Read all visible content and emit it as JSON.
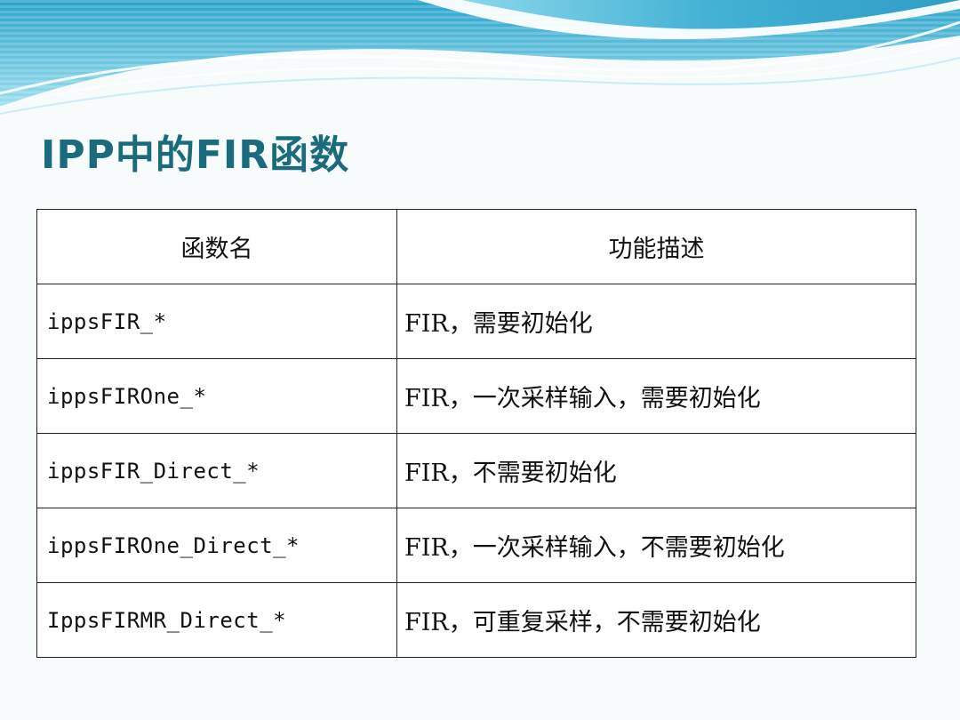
{
  "title": "IPP中的FIR函数",
  "table": {
    "headers": [
      "函数名",
      "功能描述"
    ],
    "rows": [
      {
        "name": "ippsFIR_*",
        "desc": "FIR，需要初始化"
      },
      {
        "name": "ippsFIROne_*",
        "desc": "FIR，一次采样输入，需要初始化"
      },
      {
        "name": "ippsFIR_Direct_*",
        "desc": "FIR，不需要初始化"
      },
      {
        "name": "ippsFIROne_Direct_*",
        "desc": "FIR，一次采样输入，不需要初始化"
      },
      {
        "name": "IppsFIRMR_Direct_*",
        "desc": "FIR，可重复采样，不需要初始化"
      }
    ]
  },
  "colors": {
    "title": "#1a6b7c",
    "banner": "#3ab6d6",
    "border": "#222222"
  }
}
